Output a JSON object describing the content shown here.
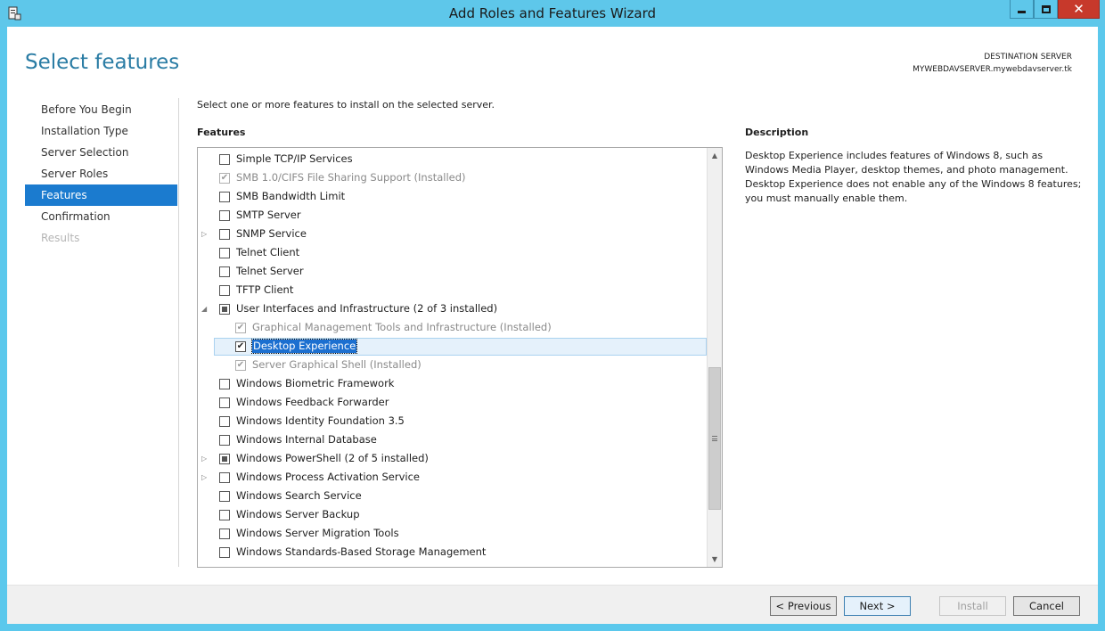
{
  "window": {
    "title": "Add Roles and Features Wizard"
  },
  "page": {
    "title": "Select features",
    "destination_label": "DESTINATION SERVER",
    "destination_server": "MYWEBDAVSERVER.mywebdavserver.tk",
    "intro": "Select one or more features to install on the selected server.",
    "features_heading": "Features"
  },
  "nav": {
    "items": [
      {
        "label": "Before You Begin",
        "state": "normal"
      },
      {
        "label": "Installation Type",
        "state": "normal"
      },
      {
        "label": "Server Selection",
        "state": "normal"
      },
      {
        "label": "Server Roles",
        "state": "normal"
      },
      {
        "label": "Features",
        "state": "active"
      },
      {
        "label": "Confirmation",
        "state": "normal"
      },
      {
        "label": "Results",
        "state": "disabled"
      }
    ]
  },
  "features": [
    {
      "label": "Simple TCP/IP Services",
      "check": "unchecked",
      "level": 0,
      "expander": ""
    },
    {
      "label": "SMB 1.0/CIFS File Sharing Support (Installed)",
      "check": "checked-grey",
      "level": 0,
      "expander": "",
      "greyed": true
    },
    {
      "label": "SMB Bandwidth Limit",
      "check": "unchecked",
      "level": 0,
      "expander": ""
    },
    {
      "label": "SMTP Server",
      "check": "unchecked",
      "level": 0,
      "expander": ""
    },
    {
      "label": "SNMP Service",
      "check": "unchecked",
      "level": 0,
      "expander": "collapsed"
    },
    {
      "label": "Telnet Client",
      "check": "unchecked",
      "level": 0,
      "expander": ""
    },
    {
      "label": "Telnet Server",
      "check": "unchecked",
      "level": 0,
      "expander": ""
    },
    {
      "label": "TFTP Client",
      "check": "unchecked",
      "level": 0,
      "expander": ""
    },
    {
      "label": "User Interfaces and Infrastructure (2 of 3 installed)",
      "check": "partial",
      "level": 0,
      "expander": "expanded"
    },
    {
      "label": "Graphical Management Tools and Infrastructure (Installed)",
      "check": "checked-grey",
      "level": 1,
      "expander": "",
      "greyed": true
    },
    {
      "label": "Desktop Experience",
      "check": "checked",
      "level": 1,
      "expander": "",
      "selected": true
    },
    {
      "label": "Server Graphical Shell (Installed)",
      "check": "checked-grey",
      "level": 1,
      "expander": "",
      "greyed": true
    },
    {
      "label": "Windows Biometric Framework",
      "check": "unchecked",
      "level": 0,
      "expander": ""
    },
    {
      "label": "Windows Feedback Forwarder",
      "check": "unchecked",
      "level": 0,
      "expander": ""
    },
    {
      "label": "Windows Identity Foundation 3.5",
      "check": "unchecked",
      "level": 0,
      "expander": ""
    },
    {
      "label": "Windows Internal Database",
      "check": "unchecked",
      "level": 0,
      "expander": ""
    },
    {
      "label": "Windows PowerShell (2 of 5 installed)",
      "check": "partial",
      "level": 0,
      "expander": "collapsed"
    },
    {
      "label": "Windows Process Activation Service",
      "check": "unchecked",
      "level": 0,
      "expander": "collapsed"
    },
    {
      "label": "Windows Search Service",
      "check": "unchecked",
      "level": 0,
      "expander": ""
    },
    {
      "label": "Windows Server Backup",
      "check": "unchecked",
      "level": 0,
      "expander": ""
    },
    {
      "label": "Windows Server Migration Tools",
      "check": "unchecked",
      "level": 0,
      "expander": ""
    },
    {
      "label": "Windows Standards-Based Storage Management",
      "check": "unchecked",
      "level": 0,
      "expander": ""
    }
  ],
  "description": {
    "heading": "Description",
    "text": "Desktop Experience includes features of Windows 8, such as Windows Media Player, desktop themes, and photo management. Desktop Experience does not enable any of the Windows 8 features; you must manually enable them."
  },
  "buttons": {
    "previous": "< Previous",
    "next": "Next >",
    "install": "Install",
    "cancel": "Cancel"
  },
  "icons": {
    "app": "server-manager-icon",
    "minimize": "minimize-icon",
    "maximize": "maximize-icon",
    "close": "close-icon"
  }
}
